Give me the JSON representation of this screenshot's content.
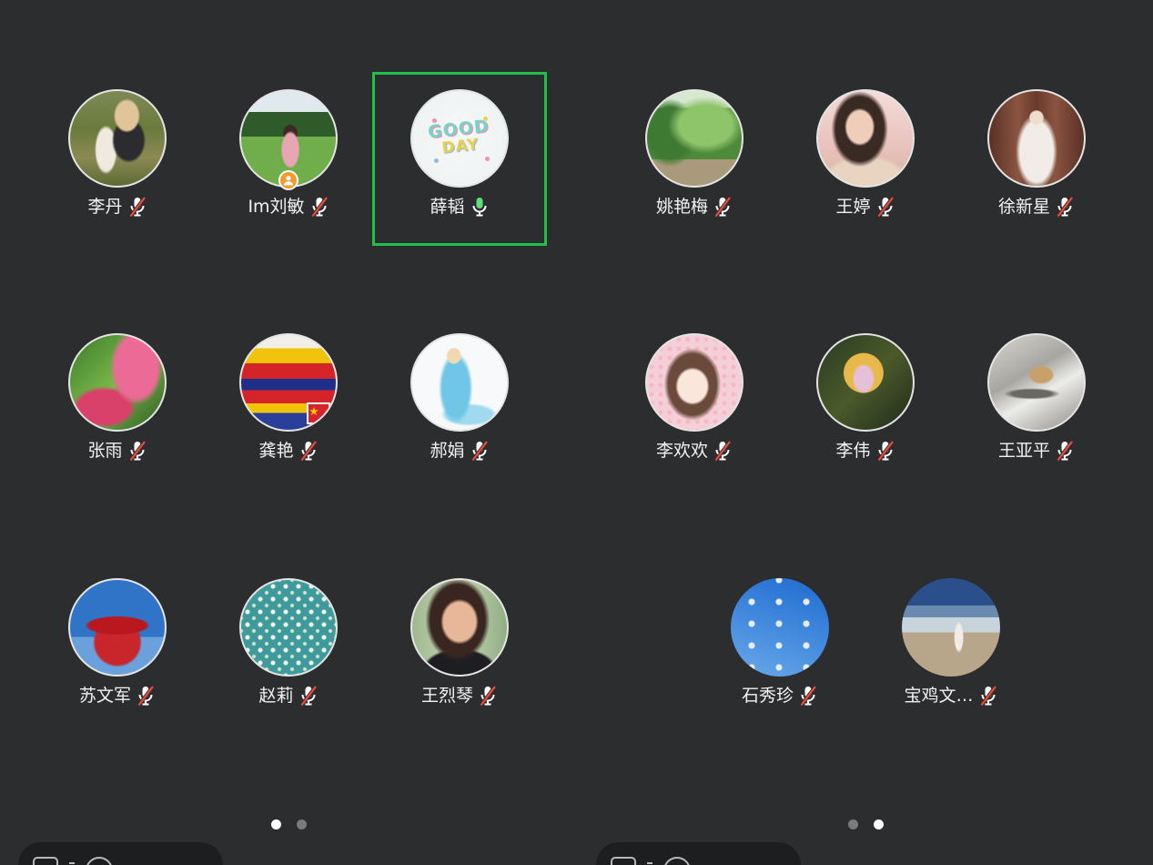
{
  "panels": [
    {
      "participants": [
        {
          "name": "李丹",
          "mic": "muted"
        },
        {
          "name": "Im刘敏",
          "mic": "muted",
          "host": true
        },
        {
          "name": "薛韬",
          "mic": "speaking",
          "highlighted": true,
          "avatar_text": [
            "GOOD",
            "DAY"
          ]
        },
        {
          "name": "张雨",
          "mic": "muted"
        },
        {
          "name": "龚艳",
          "mic": "muted"
        },
        {
          "name": "郝娟",
          "mic": "muted"
        },
        {
          "name": "苏文军",
          "mic": "muted"
        },
        {
          "name": "赵莉",
          "mic": "muted"
        },
        {
          "name": "王烈琴",
          "mic": "muted"
        }
      ],
      "page_indicator": {
        "pages": 2,
        "current": 1
      }
    },
    {
      "participants": [
        {
          "name": "姚艳梅",
          "mic": "muted"
        },
        {
          "name": "王婷",
          "mic": "muted"
        },
        {
          "name": "徐新星",
          "mic": "muted"
        },
        {
          "name": "李欢欢",
          "mic": "muted"
        },
        {
          "name": "李伟",
          "mic": "muted"
        },
        {
          "name": "王亚平",
          "mic": "muted"
        },
        {
          "name": "石秀珍",
          "mic": "muted"
        },
        {
          "name": "宝鸡文…",
          "mic": "muted"
        }
      ],
      "page_indicator": {
        "pages": 2,
        "current": 2
      }
    }
  ],
  "toolbar": {
    "icons": [
      "text-input-icon",
      "emoji-icon"
    ]
  },
  "colors": {
    "background": "#2c2d2f",
    "active_speaker_highlight": "#1fbf4a",
    "muted_slash": "#f04a3a",
    "speaking_mic": "#5ede7a",
    "host_badge": "#f39a2b"
  }
}
